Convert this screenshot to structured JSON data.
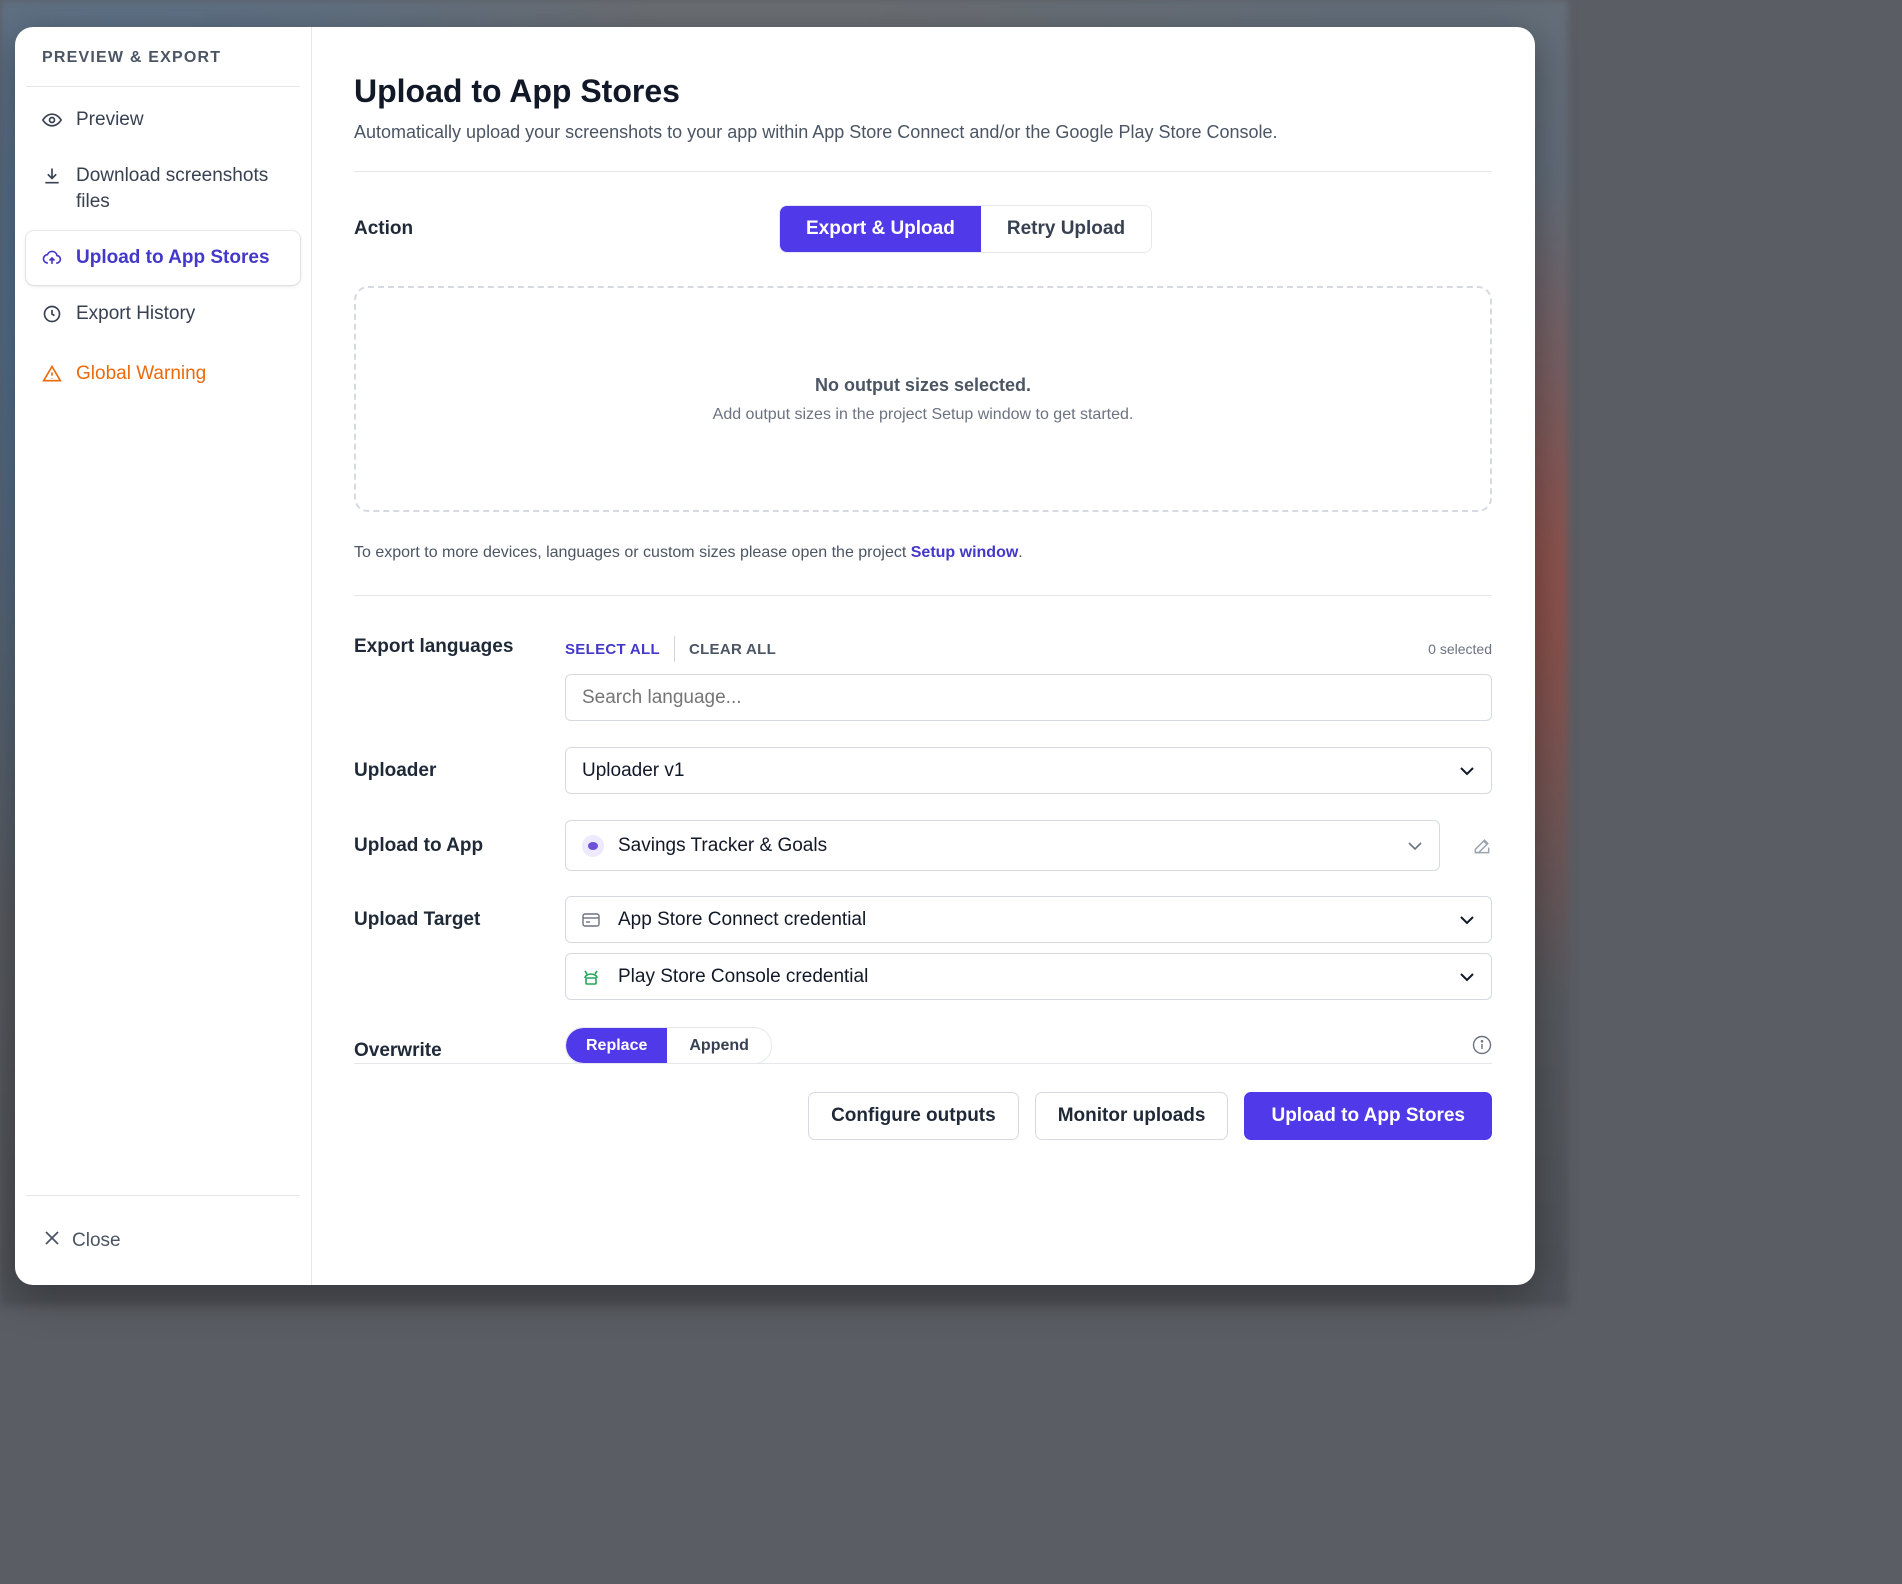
{
  "sidebar": {
    "header": "PREVIEW & EXPORT",
    "items": [
      {
        "label": "Preview",
        "icon": "eye-icon"
      },
      {
        "label": "Download screenshots files",
        "icon": "download-icon"
      },
      {
        "label": "Upload to App Stores",
        "icon": "cloud-upload-icon"
      },
      {
        "label": "Export History",
        "icon": "clock-icon"
      },
      {
        "label": "Global Warning",
        "icon": "warning-icon"
      }
    ],
    "close_label": "Close"
  },
  "main": {
    "title": "Upload to App Stores",
    "subtitle": "Automatically upload your screenshots to your app within App Store Connect and/or the Google Play Store Console.",
    "action": {
      "label": "Action",
      "options": [
        "Export & Upload",
        "Retry Upload"
      ],
      "selected": "Export & Upload"
    },
    "empty": {
      "title": "No output sizes selected.",
      "subtitle": "Add output sizes in the project Setup window to get started."
    },
    "hint": {
      "text": "To export to more devices, languages or custom sizes please open the project ",
      "link": "Setup window",
      "suffix": "."
    },
    "languages": {
      "label": "Export languages",
      "select_all": "SELECT ALL",
      "clear_all": "CLEAR ALL",
      "count": "0 selected",
      "placeholder": "Search language..."
    },
    "uploader": {
      "label": "Uploader",
      "value": "Uploader v1"
    },
    "upload_app": {
      "label": "Upload to App",
      "value": "Savings Tracker & Goals"
    },
    "upload_target": {
      "label": "Upload Target",
      "app_store": "App Store Connect credential",
      "play_store": "Play Store Console credential"
    },
    "overwrite": {
      "label": "Overwrite",
      "options": [
        "Replace",
        "Append"
      ],
      "selected": "Replace"
    },
    "buttons": {
      "configure": "Configure outputs",
      "monitor": "Monitor uploads",
      "upload": "Upload to App Stores"
    }
  },
  "colors": {
    "accent": "#4f39e8",
    "warning": "#ea6a0c",
    "active_text": "#4338ca"
  }
}
